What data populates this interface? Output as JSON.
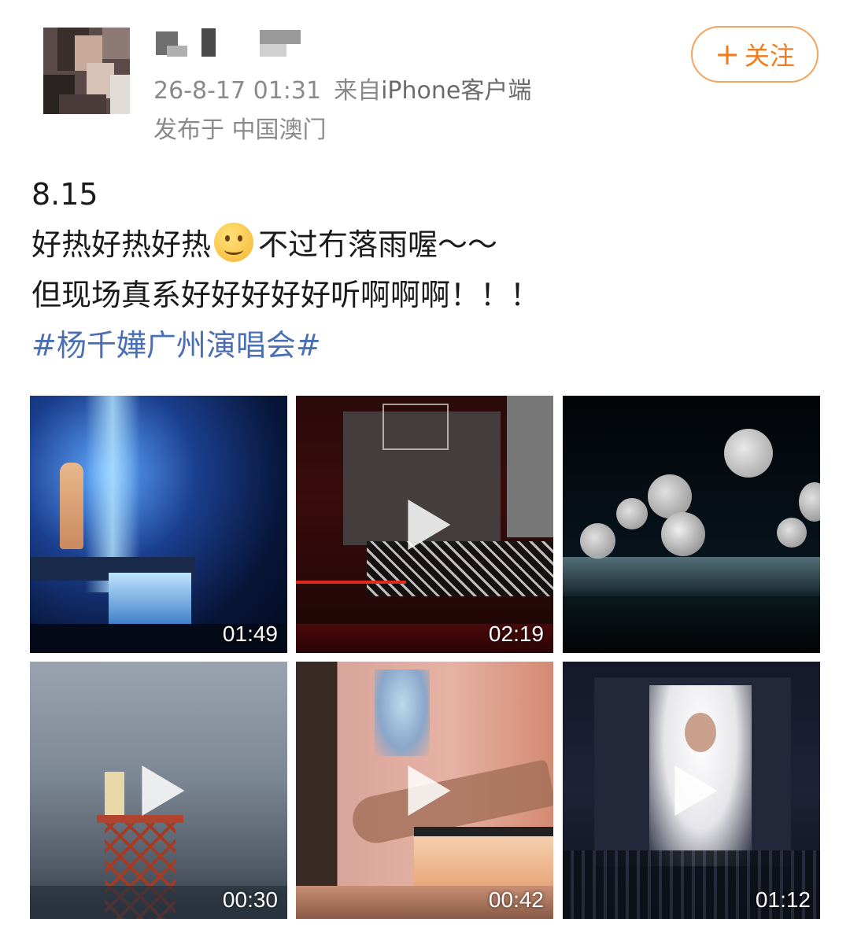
{
  "post": {
    "timestamp": "26-8-17 01:31",
    "source_prefix": "来自",
    "source": "iPhone客户端",
    "location": "发布于 中国澳门",
    "follow_label": "关注",
    "lines": [
      "8.15",
      "好热好热好热",
      "不过冇落雨喔～～",
      "但现场真系好好好好好听啊啊啊！！！"
    ],
    "hashtag": "#杨千嬅广州演唱会#"
  },
  "media": [
    {
      "type": "video",
      "duration": "01:49",
      "play_icon": false
    },
    {
      "type": "video",
      "duration": "02:19",
      "play_icon": true
    },
    {
      "type": "image",
      "duration": "",
      "play_icon": false
    },
    {
      "type": "video",
      "duration": "00:30",
      "play_icon": true
    },
    {
      "type": "video",
      "duration": "00:42",
      "play_icon": true
    },
    {
      "type": "video",
      "duration": "01:12",
      "play_icon": true
    }
  ],
  "colors": {
    "follow_accent": "#f07c1b",
    "hashtag": "#4a6fb3",
    "meta_text": "#8a8a8a"
  }
}
